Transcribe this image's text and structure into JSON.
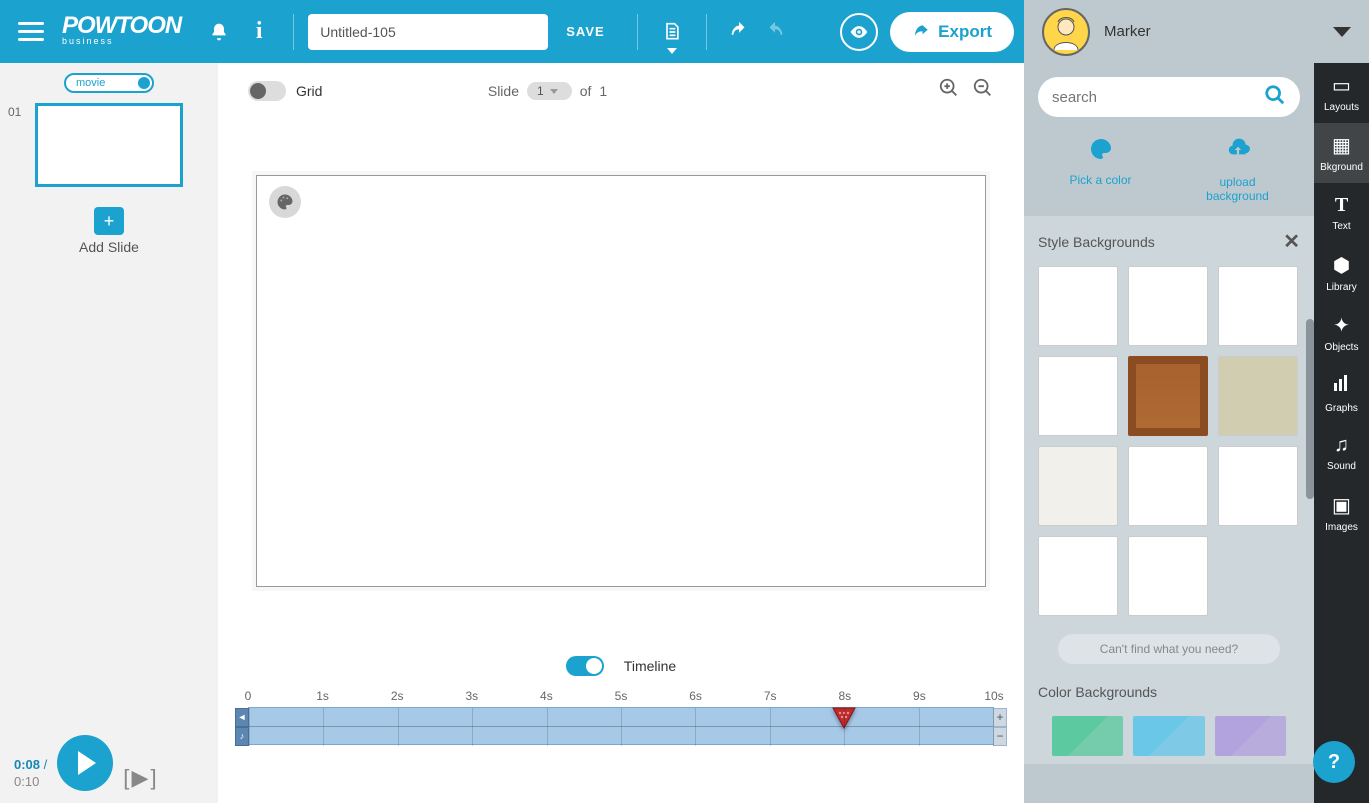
{
  "topbar": {
    "logo_main": "POWTOON",
    "logo_sub": "business",
    "title_value": "Untitled-105",
    "save": "SAVE",
    "export": "Export"
  },
  "user": {
    "name": "Marker"
  },
  "left": {
    "mode": "movie",
    "slide_num": "01",
    "add_slide": "Add Slide"
  },
  "toolrow": {
    "grid": "Grid",
    "slide_label": "Slide",
    "slide_value": "1",
    "of_label": "of",
    "total_slides": "1"
  },
  "timeline": {
    "label": "Timeline",
    "ticks": [
      "0",
      "1s",
      "2s",
      "3s",
      "4s",
      "5s",
      "6s",
      "7s",
      "8s",
      "9s",
      "10s"
    ],
    "playhead_sec": 8,
    "plus": "+",
    "minus": "−"
  },
  "playbar": {
    "current": "0:08",
    "sep": " / ",
    "total": "0:10",
    "bracket": "[ ▶ ]"
  },
  "right": {
    "search_placeholder": "search",
    "pick_color": "Pick a color",
    "upload_bg_l1": "upload",
    "upload_bg_l2": "background",
    "style_bg_header": "Style Backgrounds",
    "cant_find": "Can't find what you need?",
    "color_bg_header": "Color Backgrounds",
    "colors": [
      "#5dc9a0",
      "#6bc7e8",
      "#b2a2dd"
    ]
  },
  "strip": {
    "layouts": "Layouts",
    "bkground": "Bkground",
    "text": "Text",
    "library": "Library",
    "objects": "Objects",
    "graphs": "Graphs",
    "sound": "Sound",
    "images": "Images"
  },
  "help": "?"
}
